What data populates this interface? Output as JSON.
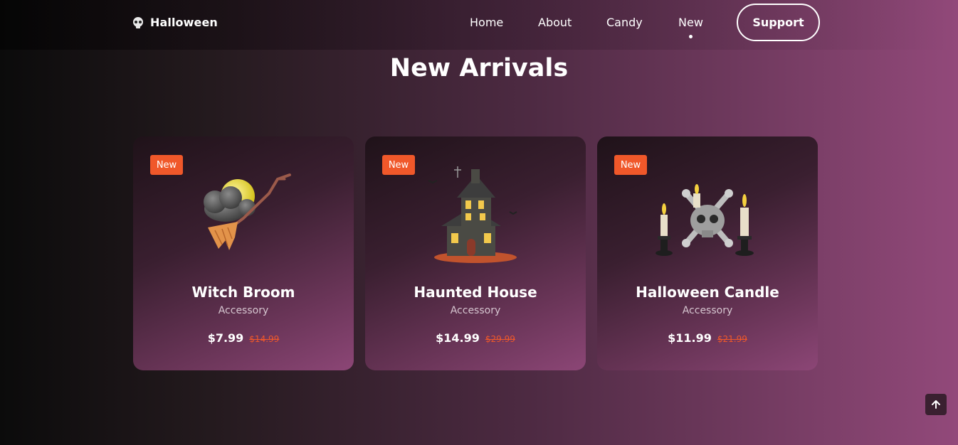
{
  "header": {
    "logo_text": "Halloween",
    "logo_icon": "skull-icon",
    "nav": [
      {
        "label": "Home"
      },
      {
        "label": "About"
      },
      {
        "label": "Candy"
      },
      {
        "label": "New",
        "active": true
      }
    ],
    "support_label": "Support"
  },
  "section": {
    "title": "New Arrivals"
  },
  "products": [
    {
      "badge": "New",
      "name": "Witch Broom",
      "category": "Accessory",
      "price": "$7.99",
      "old_price": "$14.99",
      "image_icon": "witch-broom-icon"
    },
    {
      "badge": "New",
      "name": "Haunted House",
      "category": "Accessory",
      "price": "$14.99",
      "old_price": "$29.99",
      "image_icon": "haunted-house-icon"
    },
    {
      "badge": "New",
      "name": "Halloween Candle",
      "category": "Accessory",
      "price": "$11.99",
      "old_price": "$21.99",
      "image_icon": "halloween-candle-icon"
    }
  ],
  "colors": {
    "accent": "#f0582a",
    "background_left": "#0b0b0b",
    "background_right": "#92497a"
  },
  "scroll_top_icon": "arrow-up-icon"
}
